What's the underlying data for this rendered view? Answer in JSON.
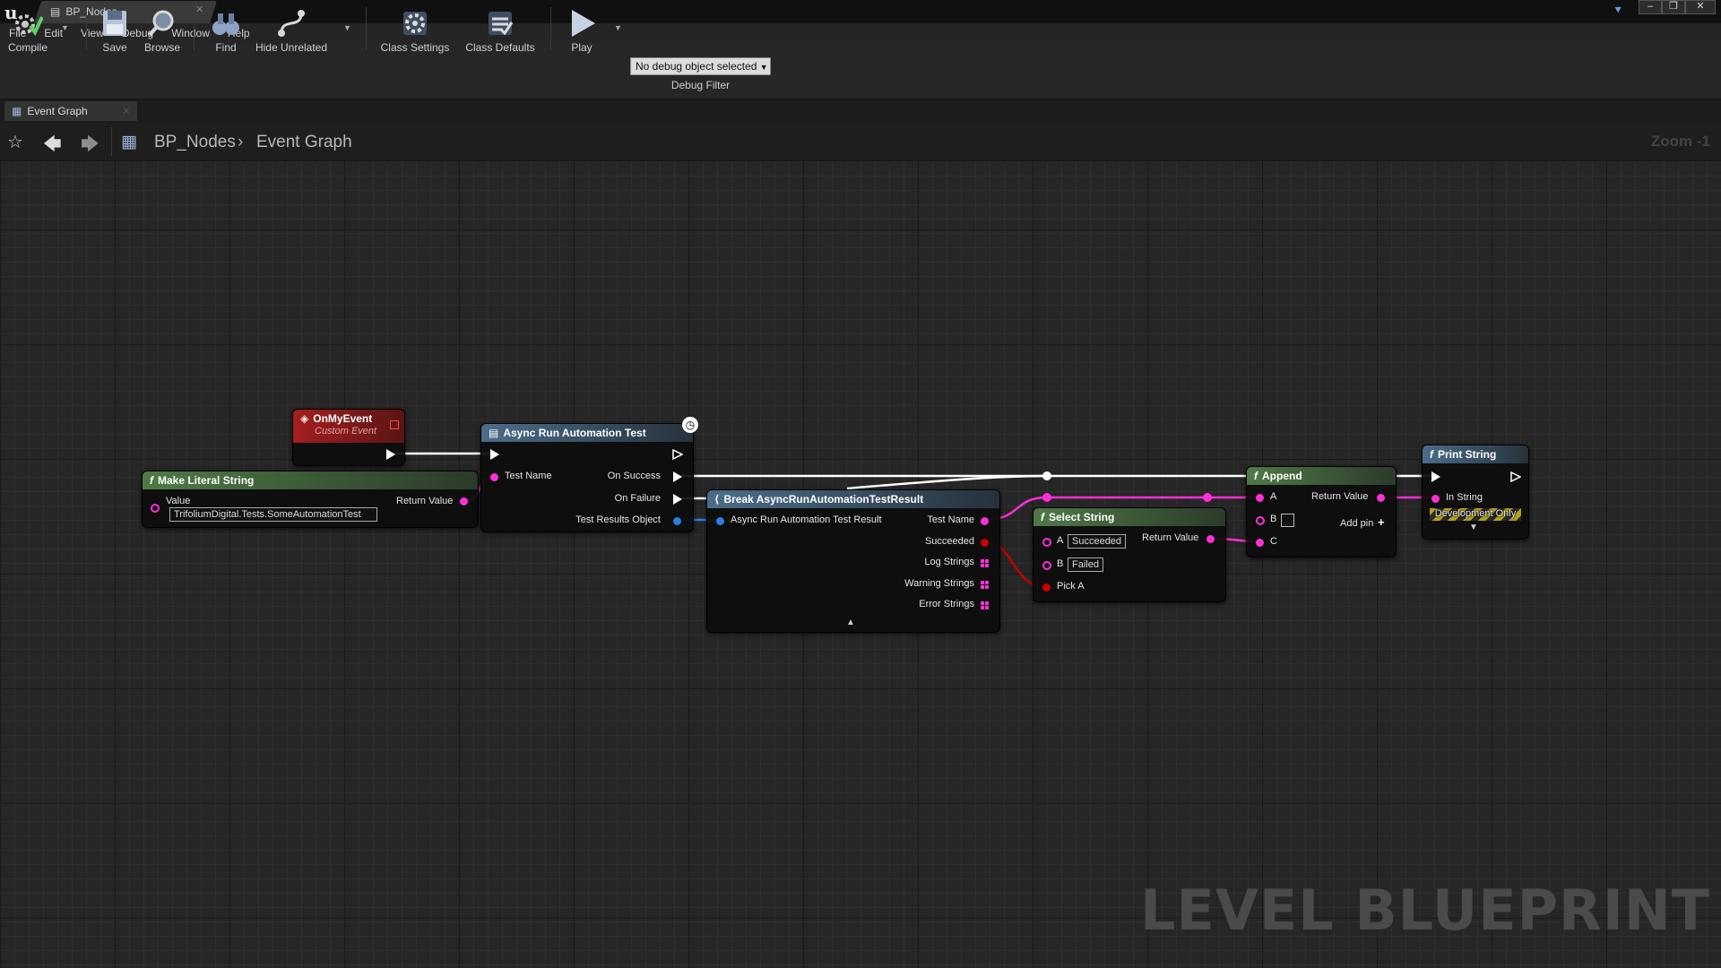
{
  "window": {
    "tab_title": "BP_Nodes"
  },
  "menu": [
    "File",
    "Edit",
    "View",
    "Debug",
    "Window",
    "Help"
  ],
  "toolbar": {
    "compile": "Compile",
    "save": "Save",
    "browse": "Browse",
    "find": "Find",
    "hide_unrelated": "Hide Unrelated",
    "class_settings": "Class Settings",
    "class_defaults": "Class Defaults",
    "play": "Play",
    "debug_select": "No debug object selected",
    "debug_filter": "Debug Filter"
  },
  "graph_tab": {
    "label": "Event Graph"
  },
  "breadcrumb": {
    "root": "BP_Nodes",
    "current": "Event Graph"
  },
  "zoom": "Zoom -1",
  "watermark": "LEVEL BLUEPRINT",
  "nodes": {
    "on_my_event": {
      "title": "OnMyEvent",
      "subtitle": "Custom Event"
    },
    "make_literal": {
      "title": "Make Literal String",
      "value_label": "Value",
      "value": "TrifoliumDigital.Tests.SomeAutomationTest",
      "return_label": "Return Value"
    },
    "async_run": {
      "title": "Async Run Automation Test",
      "test_name": "Test Name",
      "on_success": "On Success",
      "on_failure": "On Failure",
      "results": "Test Results Object"
    },
    "break_result": {
      "title": "Break AsyncRunAutomationTestResult",
      "input": "Async Run Automation Test Result",
      "test_name": "Test Name",
      "succeeded": "Succeeded",
      "log_strings": "Log Strings",
      "warning_strings": "Warning Strings",
      "error_strings": "Error Strings"
    },
    "select_string": {
      "title": "Select String",
      "a_label": "A",
      "a_value": "Succeeded",
      "b_label": "B",
      "b_value": "Failed",
      "pick_a": "Pick A",
      "return_label": "Return Value"
    },
    "append": {
      "title": "Append",
      "a": "A",
      "b": "B",
      "c": "C",
      "return_label": "Return Value",
      "add_pin": "Add pin"
    },
    "print_string": {
      "title": "Print String",
      "in_string": "In String",
      "dev_only": "Development Only"
    }
  },
  "colors": {
    "string_pin": "#ff2fd8",
    "object_pin": "#2d7ee0",
    "bool_pin": "#c00000",
    "exec_pin": "#ffffff"
  }
}
